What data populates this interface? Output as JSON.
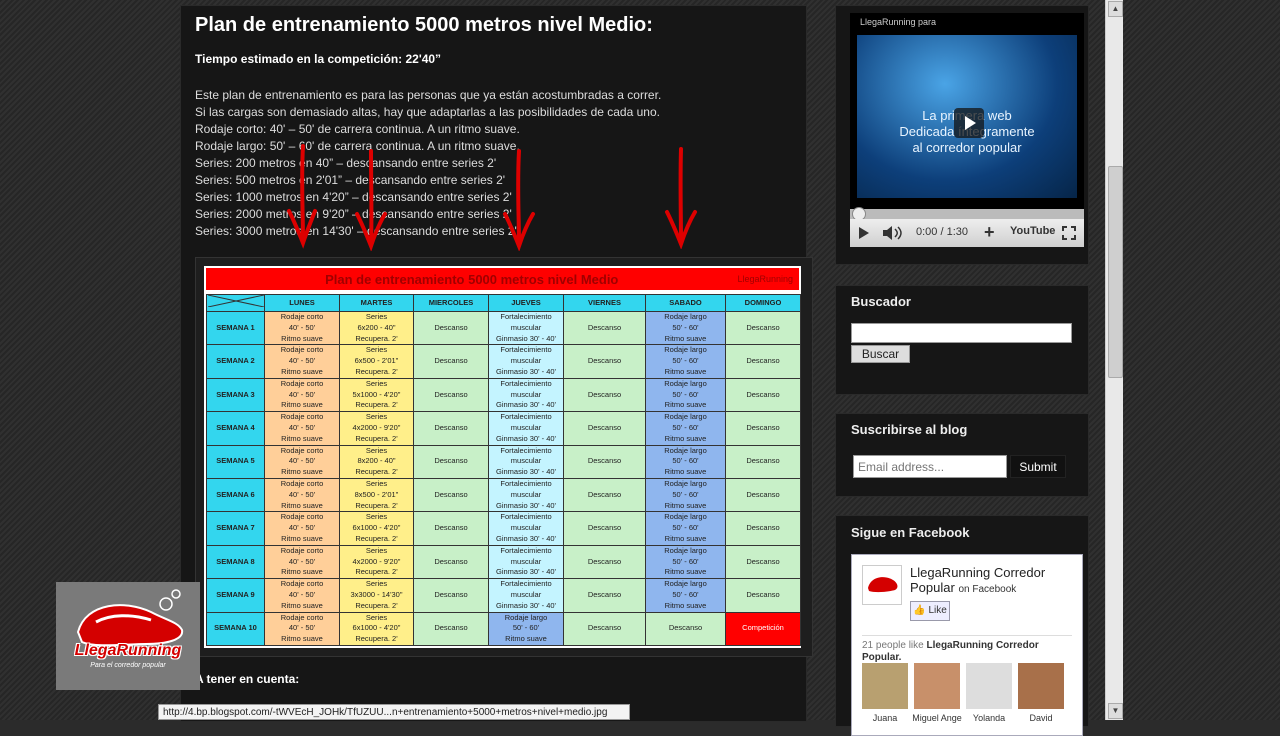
{
  "post": {
    "title": "Plan de entrenamiento 5000 metros nivel Medio:",
    "time_estimate": "Tiempo estimado en la competición: 22'40”",
    "lines": [
      "Este plan de entrenamiento es para las personas que ya están acostumbradas a correr.",
      "Si las cargas son demasiado altas, hay que adaptarlas a las posibilidades de cada uno.",
      "Rodaje corto: 40' – 50' de carrera continua. A un ritmo suave.",
      "Rodaje largo: 50' – 60' de carrera continua. A un ritmo suave.",
      "Series: 200 metros en 40” – descansando entre series 2'",
      "Series: 500 metros en 2'01” – descansando entre series 2'",
      "Series: 1000 metros en 4'20” – descansando entre series 2'",
      "Series: 2000 metros en 9'20” – descansando entre series 2'",
      "Series: 3000 metros en 14'30' – descansando entre series 2'"
    ],
    "footer_heading": "A tener en cuenta:"
  },
  "plan": {
    "title": "Plan de entrenamiento 5000 metros nivel Medio",
    "brand": "LlegaRunning",
    "days": [
      "LUNES",
      "MARTES",
      "MIERCOLES",
      "JUEVES",
      "VIERNES",
      "SABADO",
      "DOMINGO"
    ],
    "weeks": [
      {
        "label": "SEMANA 1",
        "cells": [
          "Rodaje corto\n40' - 50'\nRitmo suave",
          "Series\n6x200 - 40\"\nRecupera. 2'",
          "Descanso",
          "Fortalecimiento\nmuscular\nGinmasio 30' - 40'",
          "Descanso",
          "Rodaje largo\n50' - 60'\nRitmo suave",
          "Descanso"
        ]
      },
      {
        "label": "SEMANA 2",
        "cells": [
          "Rodaje corto\n40' - 50'\nRitmo suave",
          "Series\n6x500 - 2'01\"\nRecupera. 2'",
          "Descanso",
          "Fortalecimiento\nmuscular\nGinmasio 30' - 40'",
          "Descanso",
          "Rodaje largo\n50' - 60'\nRitmo suave",
          "Descanso"
        ]
      },
      {
        "label": "SEMANA 3",
        "cells": [
          "Rodaje corto\n40' - 50'\nRitmo suave",
          "Series\n5x1000 - 4'20\"\nRecupera. 2'",
          "Descanso",
          "Fortalecimiento\nmuscular\nGinmasio 30' - 40'",
          "Descanso",
          "Rodaje largo\n50' - 60'\nRitmo suave",
          "Descanso"
        ]
      },
      {
        "label": "SEMANA 4",
        "cells": [
          "Rodaje corto\n40' - 50'\nRitmo suave",
          "Series\n4x2000 - 9'20\"\nRecupera. 2'",
          "Descanso",
          "Fortalecimiento\nmuscular\nGinmasio 30' - 40'",
          "Descanso",
          "Rodaje largo\n50' - 60'\nRitmo suave",
          "Descanso"
        ]
      },
      {
        "label": "SEMANA 5",
        "cells": [
          "Rodaje corto\n40' - 50'\nRitmo suave",
          "Series\n8x200 - 40\"\nRecupera. 2'",
          "Descanso",
          "Fortalecimiento\nmuscular\nGinmasio 30' - 40'",
          "Descanso",
          "Rodaje largo\n50' - 60'\nRitmo suave",
          "Descanso"
        ]
      },
      {
        "label": "SEMANA 6",
        "cells": [
          "Rodaje corto\n40' - 50'\nRitmo suave",
          "Series\n8x500 - 2'01\"\nRecupera. 2'",
          "Descanso",
          "Fortalecimiento\nmuscular\nGinmasio 30' - 40'",
          "Descanso",
          "Rodaje largo\n50' - 60'\nRitmo suave",
          "Descanso"
        ]
      },
      {
        "label": "SEMANA 7",
        "cells": [
          "Rodaje corto\n40' - 50'\nRitmo suave",
          "Series\n6x1000 - 4'20\"\nRecupera. 2'",
          "Descanso",
          "Fortalecimiento\nmuscular\nGinmasio 30' - 40'",
          "Descanso",
          "Rodaje largo\n50' - 60'\nRitmo suave",
          "Descanso"
        ]
      },
      {
        "label": "SEMANA 8",
        "cells": [
          "Rodaje corto\n40' - 50'\nRitmo suave",
          "Series\n4x2000 - 9'20\"\nRecupera. 2'",
          "Descanso",
          "Fortalecimiento\nmuscular\nGinmasio 30' - 40'",
          "Descanso",
          "Rodaje largo\n50' - 60'\nRitmo suave",
          "Descanso"
        ]
      },
      {
        "label": "SEMANA 9",
        "cells": [
          "Rodaje corto\n40' - 50'\nRitmo suave",
          "Series\n3x3000 - 14'30\"\nRecupera. 2'",
          "Descanso",
          "Fortalecimiento\nmuscular\nGinmasio 30' - 40'",
          "Descanso",
          "Rodaje largo\n50' - 60'\nRitmo suave",
          "Descanso"
        ]
      },
      {
        "label": "SEMANA 10",
        "cells": [
          "Rodaje corto\n40' - 50'\nRitmo suave",
          "Series\n6x1000 - 4'20\"\nRecupera. 2'",
          "Descanso",
          "Rodaje largo\n50' - 60'\nRitmo suave",
          "Descanso",
          "Descanso",
          "Competición"
        ]
      }
    ]
  },
  "logo": {
    "name": "LlegaRunning",
    "tagline": "Para el corredor popular"
  },
  "status_bar": {
    "url": "http://4.bp.blogspot.com/-tWVEcH_JOHk/TfUZUU...n+entrenamiento+5000+metros+nivel+medio.jpg"
  },
  "video": {
    "label": "LlegaRunning para",
    "overlay_line1": "La primera web",
    "overlay_line2": "Dedicada íntegramente",
    "overlay_line3": "al corredor popular",
    "time": "0:00 / 1:30",
    "youtube": "YouTube"
  },
  "search": {
    "title": "Buscador",
    "button": "Buscar",
    "value": ""
  },
  "subscribe": {
    "title": "Suscribirse al blog",
    "placeholder": "Email address...",
    "button": "Submit"
  },
  "facebook": {
    "title": "Sigue en Facebook",
    "page_name": "LlegaRunning Corredor Popular",
    "on_facebook": "on Facebook",
    "like": "Like",
    "people_prefix": "21 people like",
    "people_page": "LlegaRunning Corredor Popular.",
    "faces": [
      "Juana",
      "Miguel Ange",
      "Yolanda",
      "David"
    ]
  },
  "colors": {
    "plan_header": "#ff0000",
    "week_col": "#33d6ee",
    "competition": "#ff0000"
  }
}
